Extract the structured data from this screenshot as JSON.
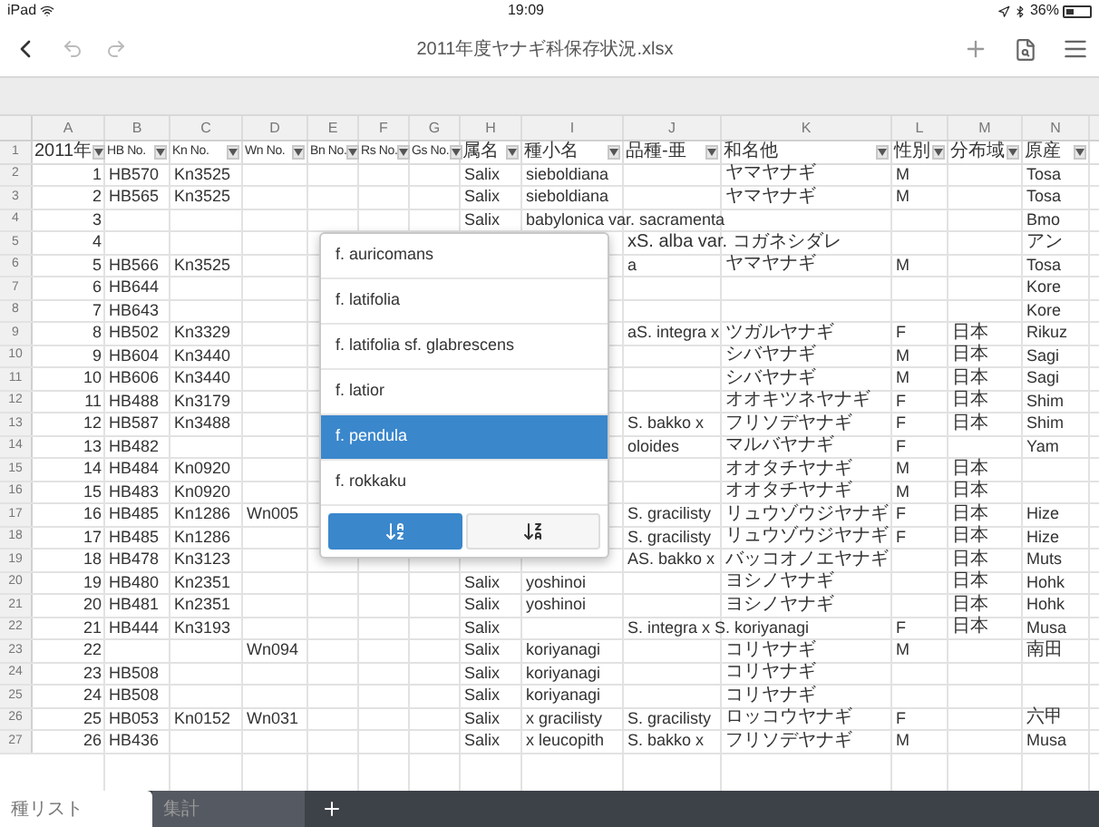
{
  "status_bar": {
    "device": "iPad",
    "time": "19:09",
    "battery": "36%"
  },
  "window": {
    "title": "2011年度ヤナギ科保存状況.xlsx"
  },
  "column_letters": [
    "A",
    "B",
    "C",
    "D",
    "E",
    "F",
    "G",
    "H",
    "I",
    "J",
    "K",
    "L",
    "M",
    "N"
  ],
  "header_row": {
    "number": "1",
    "cells": [
      "2011年",
      "HB No.",
      "Kn No.",
      "Wn No.",
      "Bn No.",
      "Rs No.",
      "Gs No.",
      "属名",
      "種小名",
      "品種-亜",
      "和名他",
      "性別",
      "分布域",
      "原産"
    ]
  },
  "rows": [
    {
      "number": "2",
      "cells": {
        "a": "1",
        "b": "HB570",
        "c": "Kn3525",
        "h": "Salix",
        "i": "sieboldiana",
        "k": "ヤマヤナギ",
        "l": "M",
        "n": "Tosa"
      }
    },
    {
      "number": "3",
      "cells": {
        "a": "2",
        "b": "HB565",
        "c": "Kn3525",
        "h": "Salix",
        "i": "sieboldiana",
        "k": "ヤマヤナギ",
        "l": "M",
        "n": "Tosa"
      }
    },
    {
      "number": "4",
      "cells": {
        "a": "3",
        "h": "Salix",
        "i": "babylonica var. sacramenta",
        "n": "Bmo"
      }
    },
    {
      "number": "5",
      "cells": {
        "a": "4",
        "j": "xS. alba var. コガネシダレ",
        "n": "アン"
      }
    },
    {
      "number": "6",
      "cells": {
        "a": "5",
        "b": "HB566",
        "c": "Kn3525",
        "j": "a",
        "k": "ヤマヤナギ",
        "l": "M",
        "n": "Tosa"
      }
    },
    {
      "number": "7",
      "cells": {
        "a": "6",
        "b": "HB644",
        "n": "Kore"
      }
    },
    {
      "number": "8",
      "cells": {
        "a": "7",
        "b": "HB643",
        "n": "Kore"
      }
    },
    {
      "number": "9",
      "cells": {
        "a": "8",
        "b": "HB502",
        "c": "Kn3329",
        "j": "aS. integra x",
        "k": "ツガルヤナギ",
        "l": "F",
        "m": "日本",
        "n": "Rikuz"
      }
    },
    {
      "number": "10",
      "cells": {
        "a": "9",
        "b": "HB604",
        "c": "Kn3440",
        "k": "シバヤナギ",
        "l": "M",
        "m": "日本",
        "n": "Sagi"
      }
    },
    {
      "number": "11",
      "cells": {
        "a": "10",
        "b": "HB606",
        "c": "Kn3440",
        "k": "シバヤナギ",
        "l": "M",
        "m": "日本",
        "n": "Sagi"
      }
    },
    {
      "number": "12",
      "cells": {
        "a": "11",
        "b": "HB488",
        "c": "Kn3179",
        "k": "オオキツネヤナギ",
        "l": "F",
        "m": "日本",
        "n": "Shim"
      }
    },
    {
      "number": "13",
      "cells": {
        "a": "12",
        "b": "HB587",
        "c": "Kn3488",
        "j": "S. bakko x",
        "k": "フリソデヤナギ",
        "l": "F",
        "m": "日本",
        "n": "Shim"
      }
    },
    {
      "number": "14",
      "cells": {
        "a": "13",
        "b": "HB482",
        "j": "oloides",
        "k": "マルバヤナギ",
        "l": "F",
        "n": "Yam"
      }
    },
    {
      "number": "15",
      "cells": {
        "a": "14",
        "b": "HB484",
        "c": "Kn0920",
        "k": "オオタチヤナギ",
        "l": "M",
        "m": "日本"
      }
    },
    {
      "number": "16",
      "cells": {
        "a": "15",
        "b": "HB483",
        "c": "Kn0920",
        "k": "オオタチヤナギ",
        "l": "M",
        "m": "日本"
      }
    },
    {
      "number": "17",
      "cells": {
        "a": "16",
        "b": "HB485",
        "c": "Kn1286",
        "d": "Wn005",
        "j": "S. gracilisty",
        "k": "リュウゾウジヤナギ",
        "l": "F",
        "m": "日本",
        "n": "Hize"
      }
    },
    {
      "number": "18",
      "cells": {
        "a": "17",
        "b": "HB485",
        "c": "Kn1286",
        "j": "S. gracilisty",
        "k": "リュウゾウジヤナギ",
        "l": "F",
        "m": "日本",
        "n": "Hize"
      }
    },
    {
      "number": "19",
      "cells": {
        "a": "18",
        "b": "HB478",
        "c": "Kn3123",
        "j": "AS. bakko x",
        "k": "バッコオノエヤナギ",
        "m": "日本",
        "n": "Muts"
      }
    },
    {
      "number": "20",
      "cells": {
        "a": "19",
        "b": "HB480",
        "c": "Kn2351",
        "h": "Salix",
        "i": "yoshinoi",
        "k": "ヨシノヤナギ",
        "m": "日本",
        "n": "Hohk"
      }
    },
    {
      "number": "21",
      "cells": {
        "a": "20",
        "b": "HB481",
        "c": "Kn2351",
        "h": "Salix",
        "i": "yoshinoi",
        "k": "ヨシノヤナギ",
        "m": "日本",
        "n": "Hohk"
      }
    },
    {
      "number": "22",
      "cells": {
        "a": "21",
        "b": "HB444",
        "c": "Kn3193",
        "h": "Salix",
        "j": "S. integra x S. koriyanagi",
        "l": "F",
        "m": "日本",
        "n": "Musa"
      }
    },
    {
      "number": "23",
      "cells": {
        "a": "22",
        "d": "Wn094",
        "h": "Salix",
        "i": "koriyanagi",
        "k": "コリヤナギ",
        "l": "M",
        "n": "南田"
      }
    },
    {
      "number": "24",
      "cells": {
        "a": "23",
        "b": "HB508",
        "h": "Salix",
        "i": "koriyanagi",
        "k": "コリヤナギ"
      }
    },
    {
      "number": "25",
      "cells": {
        "a": "24",
        "b": "HB508",
        "h": "Salix",
        "i": "koriyanagi",
        "k": "コリヤナギ"
      }
    },
    {
      "number": "26",
      "cells": {
        "a": "25",
        "b": "HB053",
        "c": "Kn0152",
        "d": "Wn031",
        "h": "Salix",
        "i": "x gracilisty",
        "j": "S. gracilisty",
        "k": "ロッコウヤナギ",
        "l": "F",
        "n": "六甲"
      }
    },
    {
      "number": "27",
      "cells": {
        "a": "26",
        "b": "HB436",
        "h": "Salix",
        "i": "x leucopith",
        "j": "S. bakko x",
        "k": "フリソデヤナギ",
        "l": "M",
        "n": "Musa"
      }
    }
  ],
  "filter_popup": {
    "items": [
      {
        "label": "f. auricomans",
        "selected": false
      },
      {
        "label": "f. latifolia",
        "selected": false
      },
      {
        "label": "f. latifolia sf. glabrescens",
        "selected": false
      },
      {
        "label": "f. latior",
        "selected": false
      },
      {
        "label": "f. pendula",
        "selected": true
      },
      {
        "label": "f. rokkaku",
        "selected": false
      }
    ],
    "sort_buttons": [
      {
        "kind": "ascending",
        "selected": true
      },
      {
        "kind": "descending",
        "selected": false
      }
    ]
  },
  "sheet_tabs": [
    {
      "label": "種リスト",
      "selected": true
    },
    {
      "label": "集計",
      "selected": false
    }
  ]
}
